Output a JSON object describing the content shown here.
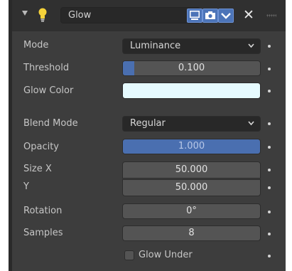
{
  "header": {
    "title": "Glow",
    "icons": [
      "collapse-triangle-icon",
      "lightbulb-icon",
      "monitor-icon",
      "camera-icon",
      "chevron-down-icon",
      "close-icon",
      "drag-grip-icon"
    ]
  },
  "colors": {
    "panel_bg": "#3d3d3d",
    "field_dark": "#282828",
    "field_mid": "#545454",
    "accent_blue": "#4a6fb0",
    "glow_color_swatch": "#e6fbff"
  },
  "properties": {
    "mode": {
      "label": "Mode",
      "value": "Luminance"
    },
    "threshold": {
      "label": "Threshold",
      "value": "0.100",
      "fraction": 0.1
    },
    "glow_color": {
      "label": "Glow Color"
    },
    "blend_mode": {
      "label": "Blend Mode",
      "value": "Regular"
    },
    "opacity": {
      "label": "Opacity",
      "value": "1.000",
      "fraction": 1.0
    },
    "size_x": {
      "label": "Size X",
      "value": "50.000"
    },
    "size_y": {
      "label": "Y",
      "value": "50.000"
    },
    "rotation": {
      "label": "Rotation",
      "value": "0°"
    },
    "samples": {
      "label": "Samples",
      "value": "8"
    },
    "glow_under": {
      "label": "Glow Under",
      "checked": false
    }
  }
}
